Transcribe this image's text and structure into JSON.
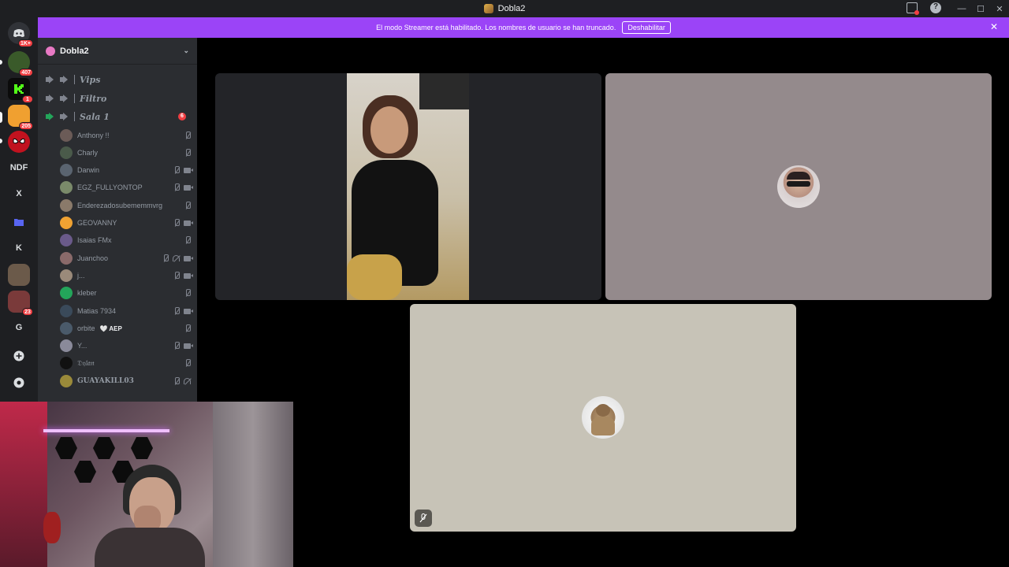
{
  "window": {
    "title": "Dobla2",
    "controls": [
      "—",
      "☐",
      "✕"
    ]
  },
  "banner": {
    "text": "El modo Streamer está habilitado. Los nombres de usuario se han truncado.",
    "button": "Deshabilitar",
    "close": "✕"
  },
  "rail": {
    "servers": [
      {
        "label": "",
        "badge": "1K+"
      },
      {
        "label": "",
        "badge": "407"
      },
      {
        "label": "",
        "badge": "1"
      },
      {
        "label": "",
        "badge": "205"
      },
      {
        "label": "",
        "badge": ""
      },
      {
        "label": "NDF",
        "badge": ""
      },
      {
        "label": "X",
        "badge": ""
      },
      {
        "label": "",
        "badge": ""
      },
      {
        "label": "K",
        "badge": ""
      },
      {
        "label": "",
        "badge": ""
      },
      {
        "label": "",
        "badge": "23"
      },
      {
        "label": "G",
        "badge": ""
      },
      {
        "label": "+",
        "badge": ""
      },
      {
        "label": "",
        "badge": ""
      }
    ]
  },
  "sidebar": {
    "guild_name": "Dobla2",
    "channels": [
      {
        "name": "Vips",
        "count": ""
      },
      {
        "name": "Filtro",
        "count": ""
      },
      {
        "name": "Sala 1",
        "count": "6"
      }
    ],
    "members": [
      {
        "name": "Anthony !!",
        "tag": "",
        "camera": false,
        "deafened": false
      },
      {
        "name": "Charly",
        "tag": "",
        "camera": false,
        "deafened": false
      },
      {
        "name": "Darwin",
        "tag": "",
        "camera": true,
        "deafened": false
      },
      {
        "name": "EGZ_FULLYONTOP",
        "tag": "",
        "camera": true,
        "deafened": false
      },
      {
        "name": "Enderezadosubememmvrg",
        "tag": "",
        "camera": false,
        "deafened": false
      },
      {
        "name": "GEOVANNY",
        "tag": "",
        "camera": true,
        "deafened": false
      },
      {
        "name": "Isaias FMx",
        "tag": "",
        "camera": false,
        "deafened": false
      },
      {
        "name": "Juanchoo",
        "tag": "",
        "camera": true,
        "deafened": true
      },
      {
        "name": "j...",
        "tag": "",
        "camera": true,
        "deafened": false
      },
      {
        "name": "kleber",
        "tag": "",
        "camera": false,
        "deafened": false
      },
      {
        "name": "Matias 7934",
        "tag": "",
        "camera": true,
        "deafened": false
      },
      {
        "name": "orbite",
        "tag": "🤍 AEP",
        "camera": false,
        "deafened": false
      },
      {
        "name": "Y...",
        "tag": "",
        "camera": true,
        "deafened": false
      },
      {
        "name": "𝔇𝔶𝔩𝔞𝔫",
        "tag": "",
        "camera": false,
        "deafened": false
      },
      {
        "name": "GUAYAKILL03",
        "tag": "",
        "camera": false,
        "deafened": true
      }
    ]
  },
  "colors": {
    "banner": "#9b44f7",
    "rail": "#1e1f22",
    "sidebar": "#2b2d31",
    "voice_active": "#23a55a",
    "badge": "#f23f43"
  }
}
